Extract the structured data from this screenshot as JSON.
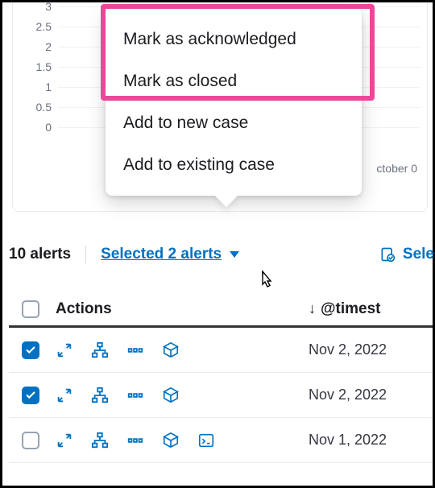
{
  "chart_data": {
    "type": "bar",
    "y_ticks": [
      3,
      2.5,
      2,
      1.5,
      1,
      0.5,
      0
    ],
    "x_visible_label": "ctober 0",
    "note": "y-axis ticks only partially visible; bars and full x-axis are obscured by popover"
  },
  "popover": {
    "items": [
      "Mark as acknowledged",
      "Mark as closed",
      "Add to new case",
      "Add to existing case"
    ]
  },
  "toolbar": {
    "alert_count": "10 alerts",
    "selected_label": "Selected 2 alerts",
    "select_all_partial": "Sele"
  },
  "table": {
    "columns": {
      "actions": "Actions",
      "timestamp_partial": "@timest"
    },
    "sort_dir_icon": "↓",
    "rows": [
      {
        "checked": true,
        "timestamp": "Nov 2, 2022",
        "has_analyze": false
      },
      {
        "checked": true,
        "timestamp": "Nov 2, 2022",
        "has_analyze": false
      },
      {
        "checked": false,
        "timestamp": "Nov 1, 2022",
        "has_analyze": true
      }
    ]
  }
}
